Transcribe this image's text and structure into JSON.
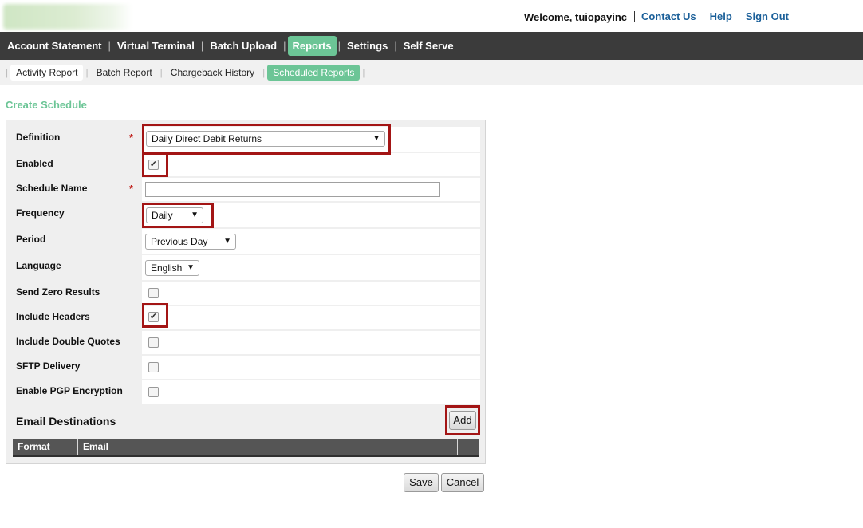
{
  "header": {
    "welcome": "Welcome, tuiopayinc",
    "links": [
      "Contact Us",
      "Help",
      "Sign Out"
    ]
  },
  "main_nav": {
    "items": [
      "Account Statement",
      "Virtual Terminal",
      "Batch Upload",
      "Reports",
      "Settings",
      "Self Serve"
    ],
    "active": "Reports"
  },
  "sub_nav": {
    "items": [
      "Activity Report",
      "Batch Report",
      "Chargeback History",
      "Scheduled Reports"
    ],
    "active": "Scheduled Reports"
  },
  "page": {
    "title": "Create Schedule"
  },
  "form": {
    "definition": {
      "label": "Definition",
      "required": "*",
      "value": "Daily Direct Debit Returns"
    },
    "enabled": {
      "label": "Enabled",
      "checked": true,
      "check_glyph": "✔"
    },
    "schedule_name": {
      "label": "Schedule Name",
      "required": "*",
      "value": ""
    },
    "frequency": {
      "label": "Frequency",
      "value": "Daily"
    },
    "period": {
      "label": "Period",
      "value": "Previous Day"
    },
    "language": {
      "label": "Language",
      "value": "English"
    },
    "send_zero_results": {
      "label": "Send Zero Results",
      "checked": false,
      "check_glyph": ""
    },
    "include_headers": {
      "label": "Include Headers",
      "checked": true,
      "check_glyph": "✔"
    },
    "include_double_quotes": {
      "label": "Include Double Quotes",
      "checked": false,
      "check_glyph": ""
    },
    "sftp_delivery": {
      "label": "SFTP Delivery",
      "checked": false,
      "check_glyph": ""
    },
    "enable_pgp": {
      "label": "Enable PGP Encryption",
      "checked": false,
      "check_glyph": ""
    }
  },
  "email_destinations": {
    "title": "Email Destinations",
    "add_label": "Add",
    "columns": [
      "Format",
      "Email"
    ]
  },
  "actions": {
    "save": "Save",
    "cancel": "Cancel"
  },
  "colors": {
    "accent": "#6cc596",
    "nav_bg": "#3b3b3b",
    "highlight": "#a31515",
    "link": "#1a5f99",
    "required": "#c0211c"
  }
}
